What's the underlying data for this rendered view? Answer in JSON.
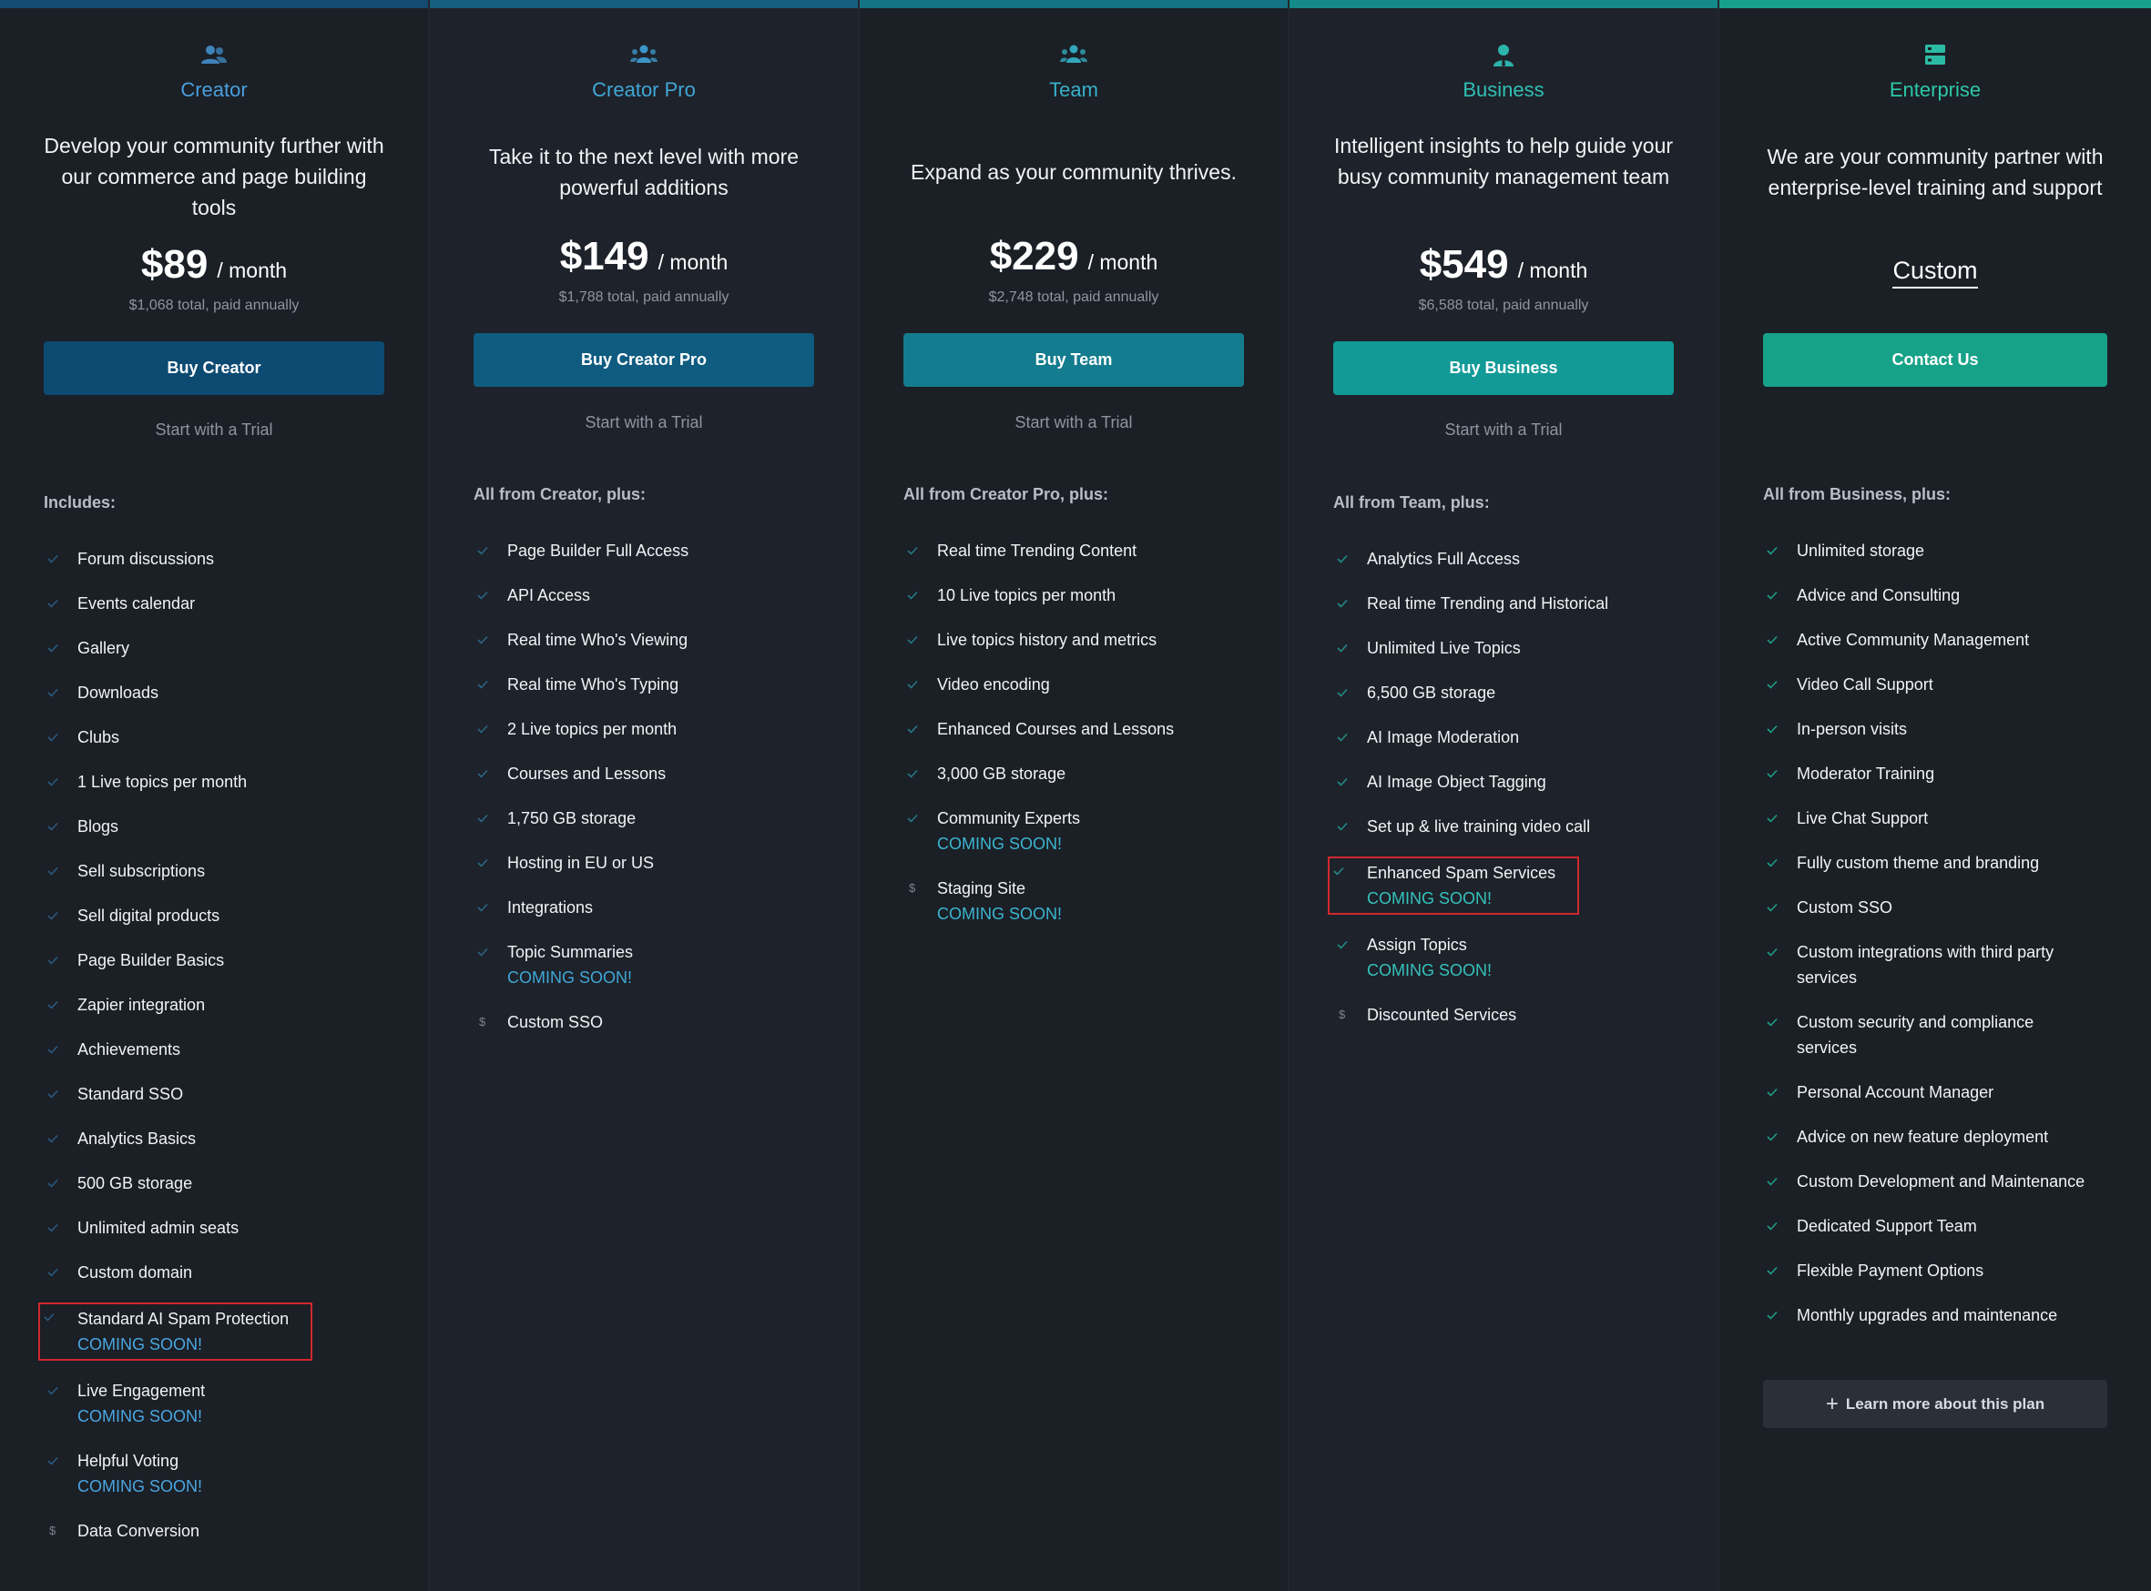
{
  "colors": {
    "creator_accent": "#4a9fdc",
    "creator_pro_accent": "#3fa7d6",
    "team_accent": "#37b0c9",
    "business_accent": "#2fc0b5",
    "enterprise_accent": "#2cc8a8",
    "coming_soon": "#3fb3d6",
    "highlight_box": "#d0282e"
  },
  "plans": [
    {
      "name": "Creator",
      "icon": "users-icon",
      "tagline": "Develop your community further with our commerce and page building tools",
      "price": "$89",
      "per": "/ month",
      "price_note": "$1,068 total, paid annually",
      "button": "Buy Creator",
      "trial": "Start with a Trial",
      "includes_title": "Includes:",
      "features": [
        {
          "label": "Forum discussions"
        },
        {
          "label": "Events calendar"
        },
        {
          "label": "Gallery"
        },
        {
          "label": "Downloads"
        },
        {
          "label": "Clubs"
        },
        {
          "label": "1 Live topics per month"
        },
        {
          "label": "Blogs"
        },
        {
          "label": "Sell subscriptions"
        },
        {
          "label": "Sell digital products"
        },
        {
          "label": "Page Builder Basics"
        },
        {
          "label": "Zapier integration"
        },
        {
          "label": "Achievements"
        },
        {
          "label": "Standard SSO"
        },
        {
          "label": "Analytics Basics"
        },
        {
          "label": "500 GB storage"
        },
        {
          "label": "Unlimited admin seats"
        },
        {
          "label": "Custom domain"
        },
        {
          "label": "Standard AI Spam Protection",
          "soon": "COMING SOON!"
        },
        {
          "label": "Live Engagement",
          "soon": "COMING SOON!"
        },
        {
          "label": "Helpful Voting",
          "soon": "COMING SOON!"
        },
        {
          "label": "Data Conversion",
          "icon": "dollar-icon"
        }
      ]
    },
    {
      "name": "Creator Pro",
      "icon": "users-icon",
      "tagline": "Take it to the next level with more powerful additions",
      "price": "$149",
      "per": "/ month",
      "price_note": "$1,788 total, paid annually",
      "button": "Buy Creator Pro",
      "trial": "Start with a Trial",
      "includes_title": "All from Creator, plus:",
      "features": [
        {
          "label": "Page Builder Full Access"
        },
        {
          "label": "API Access"
        },
        {
          "label": "Real time Who's Viewing"
        },
        {
          "label": "Real time Who's Typing"
        },
        {
          "label": "2 Live topics per month"
        },
        {
          "label": "Courses and Lessons"
        },
        {
          "label": "1,750 GB storage"
        },
        {
          "label": "Hosting in EU or US"
        },
        {
          "label": "Integrations"
        },
        {
          "label": "Topic Summaries",
          "soon": "COMING SOON!"
        },
        {
          "label": "Custom SSO",
          "icon": "dollar-icon"
        }
      ]
    },
    {
      "name": "Team",
      "icon": "users-icon",
      "tagline": "Expand as your community thrives.",
      "price": "$229",
      "per": "/ month",
      "price_note": "$2,748 total, paid annually",
      "button": "Buy Team",
      "trial": "Start with a Trial",
      "includes_title": "All from Creator Pro, plus:",
      "features": [
        {
          "label": "Real time Trending Content"
        },
        {
          "label": "10 Live topics per month"
        },
        {
          "label": "Live topics history and metrics"
        },
        {
          "label": "Video encoding"
        },
        {
          "label": "Enhanced Courses and Lessons"
        },
        {
          "label": "3,000 GB storage"
        },
        {
          "label": "Community Experts",
          "soon": "COMING SOON!"
        },
        {
          "label": "Staging Site",
          "soon": "COMING SOON!",
          "icon": "dollar-icon"
        }
      ]
    },
    {
      "name": "Business",
      "icon": "user-tie-icon",
      "tagline": "Intelligent insights to help guide your busy community management team",
      "price": "$549",
      "per": "/ month",
      "price_note": "$6,588 total, paid annually",
      "button": "Buy Business",
      "trial": "Start with a Trial",
      "includes_title": "All from Team, plus:",
      "features": [
        {
          "label": "Analytics Full Access"
        },
        {
          "label": "Real time Trending and Historical"
        },
        {
          "label": "Unlimited Live Topics"
        },
        {
          "label": "6,500 GB storage"
        },
        {
          "label": "AI Image Moderation"
        },
        {
          "label": "AI Image Object Tagging"
        },
        {
          "label": "Set up & live training video call"
        },
        {
          "label": "Enhanced Spam Services",
          "soon": "COMING SOON!"
        },
        {
          "label": "Assign Topics",
          "soon": "COMING SOON!"
        },
        {
          "label": "Discounted Services",
          "icon": "dollar-icon"
        }
      ]
    },
    {
      "name": "Enterprise",
      "icon": "server-icon",
      "tagline": "We are your community partner with enterprise-level training and support",
      "custom_price": "Custom",
      "button": "Contact Us",
      "includes_title": "All from Business, plus:",
      "features": [
        {
          "label": "Unlimited storage"
        },
        {
          "label": "Advice and Consulting"
        },
        {
          "label": "Active Community Management"
        },
        {
          "label": "Video Call Support"
        },
        {
          "label": "In-person visits"
        },
        {
          "label": "Moderator Training"
        },
        {
          "label": "Live Chat Support"
        },
        {
          "label": "Fully custom theme and branding"
        },
        {
          "label": "Custom SSO"
        },
        {
          "label": "Custom integrations with third party services"
        },
        {
          "label": "Custom security and compliance services"
        },
        {
          "label": "Personal Account Manager"
        },
        {
          "label": "Advice on new feature deployment"
        },
        {
          "label": "Custom Development and Maintenance"
        },
        {
          "label": "Dedicated Support Team"
        },
        {
          "label": "Flexible Payment Options"
        },
        {
          "label": "Monthly upgrades and maintenance"
        }
      ],
      "learn_more": "Learn more about this plan"
    }
  ]
}
